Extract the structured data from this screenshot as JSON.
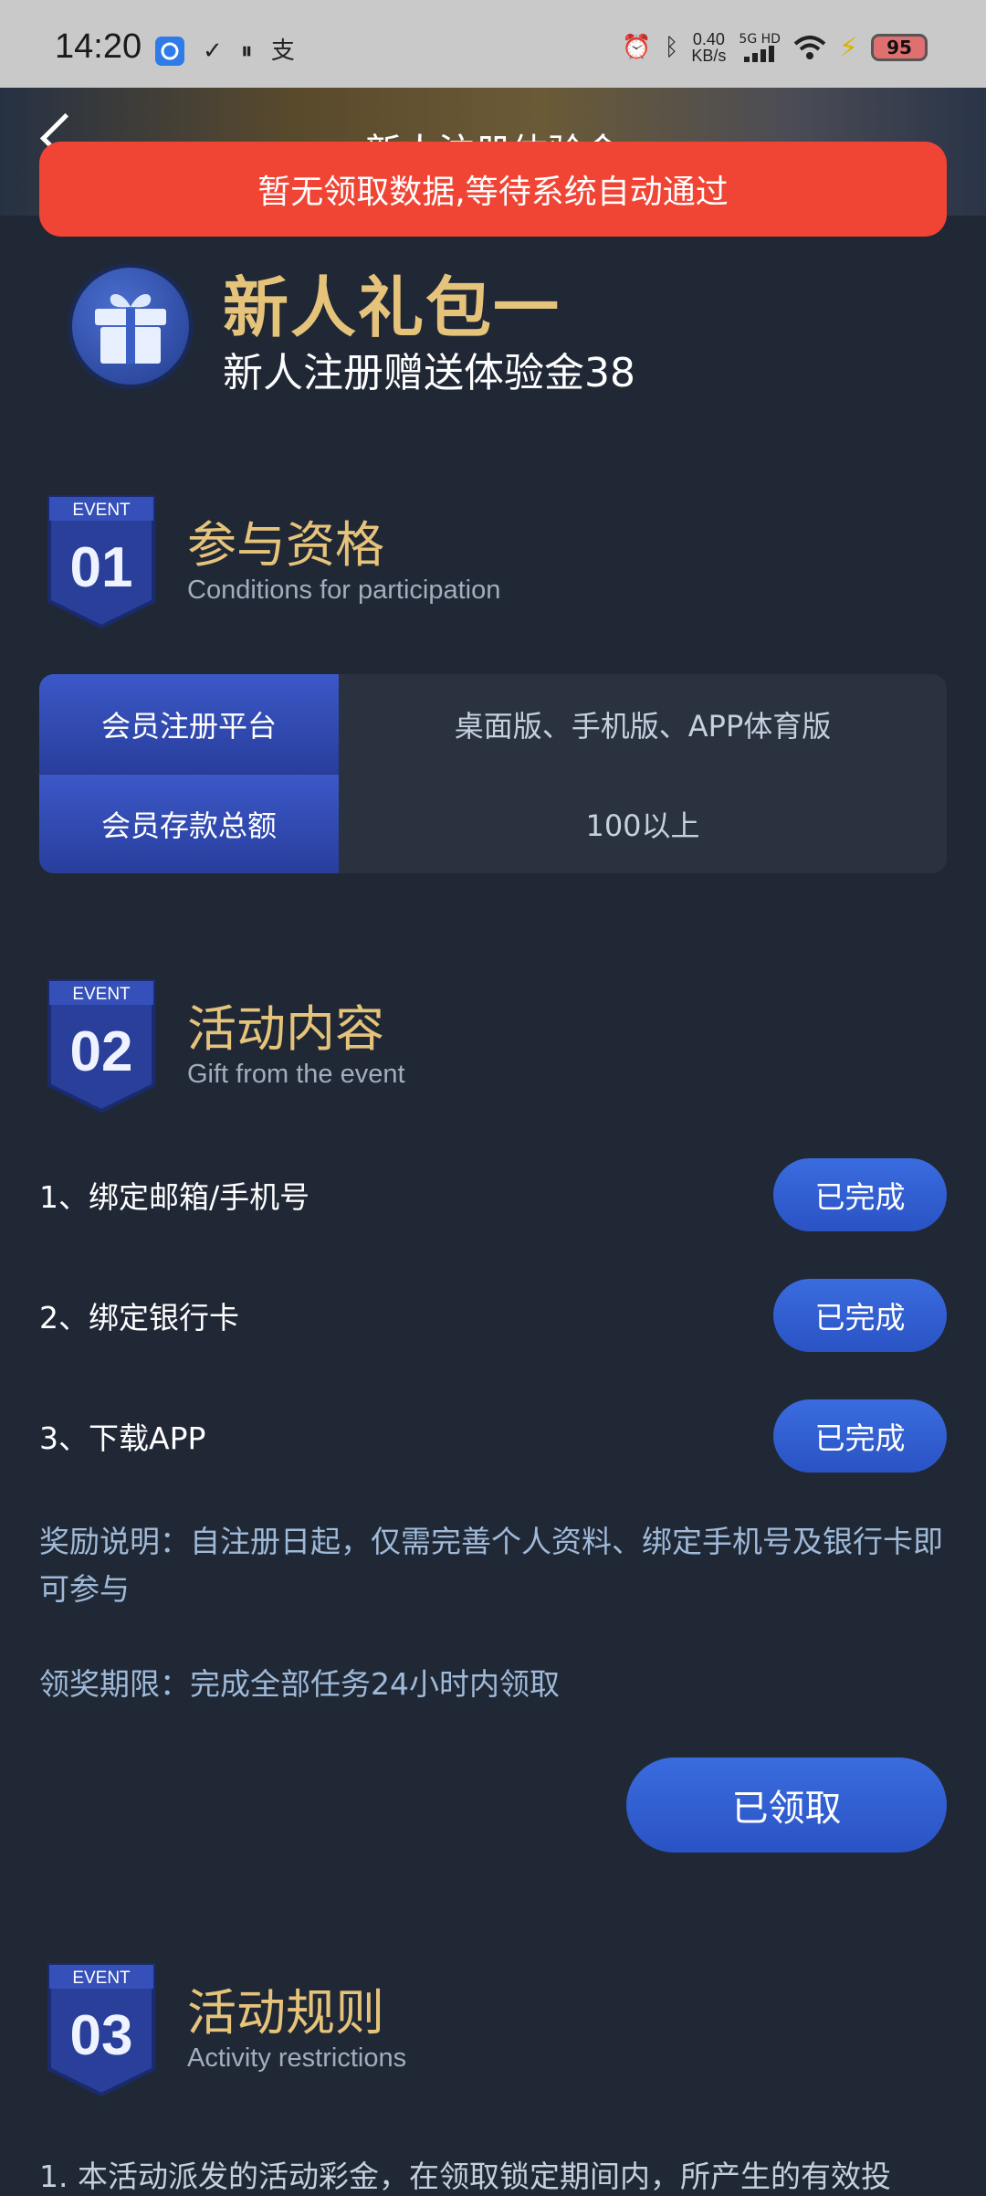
{
  "status_bar": {
    "time": "14:20",
    "speed_value": "0.40",
    "speed_unit": "KB/s",
    "network": "5G HD",
    "battery": "95"
  },
  "nav": {
    "title": "新人注册体验金"
  },
  "toast": "暂无领取数据,等待系统自动通过",
  "package": {
    "title": "新人礼包一",
    "subtitle": "新人注册赠送体验金38"
  },
  "sections": [
    {
      "badge_top": "EVENT",
      "badge_num": "01",
      "title": "参与资格",
      "subtitle": "Conditions for participation"
    },
    {
      "badge_top": "EVENT",
      "badge_num": "02",
      "title": "活动内容",
      "subtitle": "Gift from the event"
    },
    {
      "badge_top": "EVENT",
      "badge_num": "03",
      "title": "活动规则",
      "subtitle": "Activity restrictions"
    }
  ],
  "conditions": [
    {
      "label": "会员注册平台",
      "value": "桌面版、手机版、APP体育版"
    },
    {
      "label": "会员存款总额",
      "value": "100以上"
    }
  ],
  "tasks": [
    {
      "label": "1、绑定邮箱/手机号",
      "status": "已完成"
    },
    {
      "label": "2、绑定银行卡",
      "status": "已完成"
    },
    {
      "label": "3、下载APP",
      "status": "已完成"
    }
  ],
  "reward_note": "奖励说明：自注册日起，仅需完善个人资料、绑定手机号及银行卡即可参与",
  "deadline_note": "领奖期限：完成全部任务24小时内领取",
  "claim_button": "已领取",
  "rules_first_line": "1. 本活动派发的活动彩金，在领取锁定期间内，所产生的有效投"
}
